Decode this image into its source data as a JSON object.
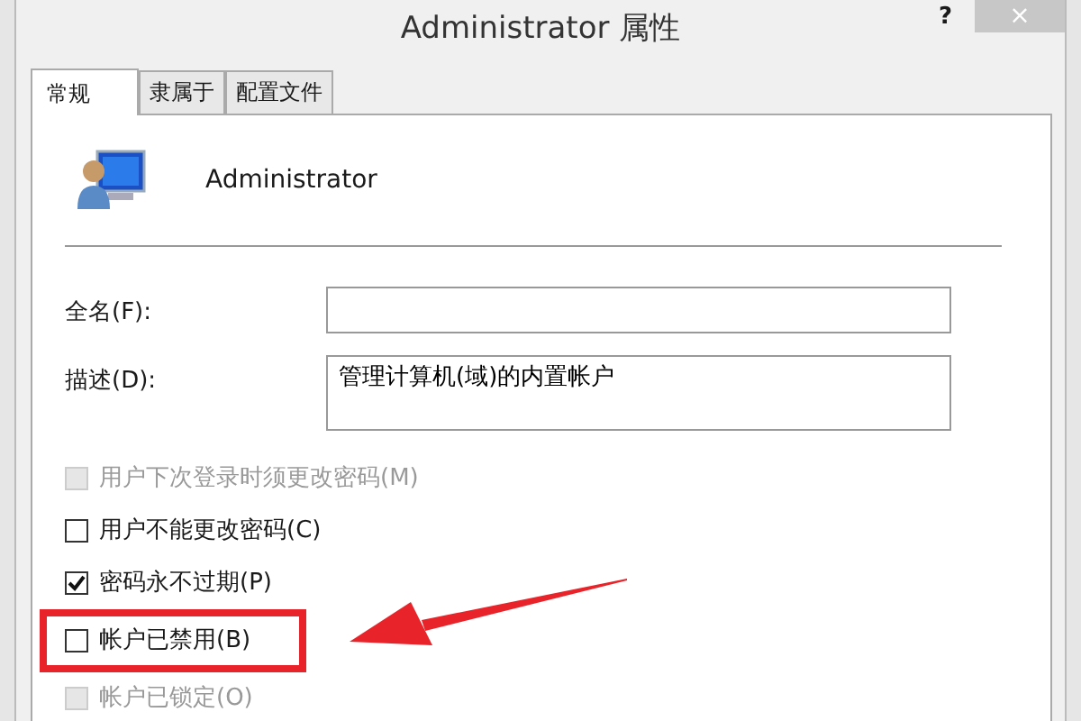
{
  "window": {
    "title": "Administrator 属性",
    "help": "?",
    "close": "×"
  },
  "tabs": [
    {
      "label": "常规",
      "selected": true
    },
    {
      "label": "隶属于",
      "selected": false
    },
    {
      "label": "配置文件",
      "selected": false
    }
  ],
  "user": {
    "name": "Administrator"
  },
  "fields": [
    {
      "label": "全名(F):",
      "kind": "line"
    },
    {
      "label": "描述(D):",
      "value": "管理计算机(域)的内置帐户",
      "kind": "area"
    }
  ],
  "options": [
    {
      "label": "用户下次登录时须更改密码(M)",
      "checked": false,
      "disabled": true,
      "highlighted": false
    },
    {
      "label": "用户不能更改密码(C)",
      "checked": false,
      "disabled": false,
      "highlighted": false
    },
    {
      "label": "密码永不过期(P)",
      "checked": true,
      "disabled": false,
      "highlighted": false
    },
    {
      "label": "帐户已禁用(B)",
      "checked": false,
      "disabled": false,
      "highlighted": true
    },
    {
      "label": "帐户已锁定(O)",
      "checked": false,
      "disabled": true,
      "highlighted": false
    }
  ]
}
